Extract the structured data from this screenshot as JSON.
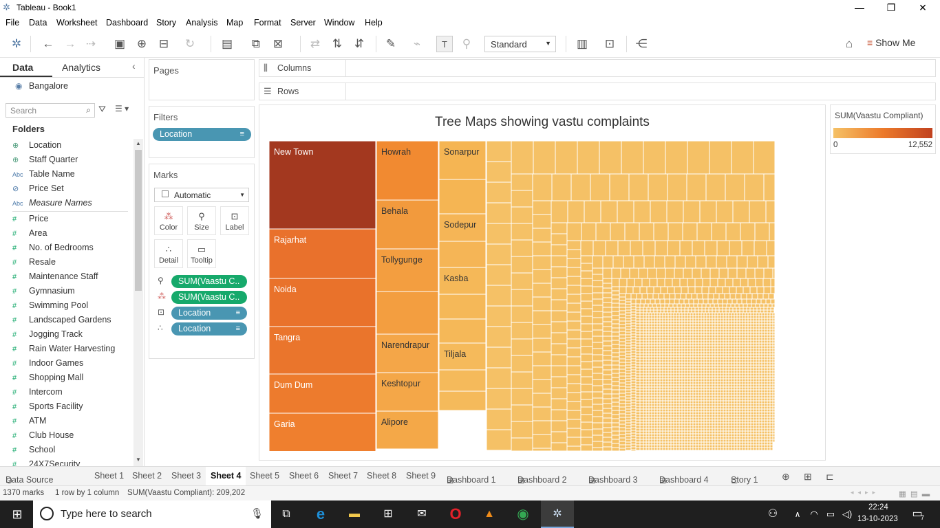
{
  "window": {
    "title": "Tableau - Book1"
  },
  "menu": [
    "File",
    "Data",
    "Worksheet",
    "Dashboard",
    "Story",
    "Analysis",
    "Map",
    "Format",
    "Server",
    "Window",
    "Help"
  ],
  "toolbar": {
    "fit_mode": "Standard",
    "show_me": "Show Me"
  },
  "datapane": {
    "tab_data": "Data",
    "tab_analytics": "Analytics",
    "datasource": "Bangalore",
    "search_placeholder": "Search",
    "folders_label": "Folders",
    "dimensions": [
      {
        "icon": "globe",
        "label": "Location"
      },
      {
        "icon": "globe",
        "label": "Staff Quarter"
      },
      {
        "icon": "abc",
        "label": "Table Name"
      },
      {
        "icon": "set",
        "label": "Price Set"
      },
      {
        "icon": "abc",
        "label": "Measure Names"
      }
    ],
    "measures": [
      "Price",
      "Area",
      "No. of Bedrooms",
      "Resale",
      "Maintenance Staff",
      "Gymnasium",
      "Swimming Pool",
      "Landscaped Gardens",
      "Jogging Track",
      "Rain Water Harvesting",
      "Indoor Games",
      "Shopping Mall",
      "Intercom",
      "Sports Facility",
      "ATM",
      "Club House",
      "School",
      "24X7Security"
    ]
  },
  "shelves": {
    "pages": "Pages",
    "filters": "Filters",
    "marks": "Marks",
    "columns": "Columns",
    "rows": "Rows",
    "filter_pill": "Location",
    "mark_type": "Automatic",
    "mark_buttons": [
      "Color",
      "Size",
      "Label",
      "Detail",
      "Tooltip"
    ],
    "mark_pills": [
      {
        "kind": "size",
        "label": "SUM(Vaastu C..",
        "color": "green"
      },
      {
        "kind": "color",
        "label": "SUM(Vaastu C..",
        "color": "green"
      },
      {
        "kind": "label",
        "label": "Location",
        "color": "blue"
      },
      {
        "kind": "detail",
        "label": "Location",
        "color": "blue"
      }
    ]
  },
  "legend": {
    "title": "SUM(Vaastu Compliant)",
    "min": "0",
    "max": "12,552",
    "colors": [
      "#f5c166",
      "#c1421f"
    ]
  },
  "chart_data": {
    "type": "treemap",
    "title": "Tree Maps showing vastu complaints",
    "measure": "SUM(Vaastu Compliant)",
    "labeled_tiles": [
      {
        "label": "New Town",
        "color": "#a3381f"
      },
      {
        "label": "Rajarhat",
        "color": "#e9712c"
      },
      {
        "label": "Noida",
        "color": "#e9722b"
      },
      {
        "label": "Tangra",
        "color": "#ea752c"
      },
      {
        "label": "Dum Dum",
        "color": "#ed7b2d"
      },
      {
        "label": "Garia",
        "color": "#ef7f2e"
      },
      {
        "label": "Howrah",
        "color": "#f18a31"
      },
      {
        "label": "Behala",
        "color": "#f29a3d"
      },
      {
        "label": "Tollygunge",
        "color": "#f39e40"
      },
      {
        "label": "",
        "color": "#f39e40"
      },
      {
        "label": "Narendrapur",
        "color": "#f4a648"
      },
      {
        "label": "Keshtopur",
        "color": "#f4a748"
      },
      {
        "label": "Alipore",
        "color": "#f4a848"
      },
      {
        "label": "Sonarpur",
        "color": "#f5b553"
      },
      {
        "label": "",
        "color": "#f5b553"
      },
      {
        "label": "Sodepur",
        "color": "#f5b556"
      },
      {
        "label": "",
        "color": "#f5b556"
      },
      {
        "label": "Kasba",
        "color": "#f5b858"
      },
      {
        "label": "",
        "color": "#f5b858"
      },
      {
        "label": "",
        "color": "#f5b858"
      },
      {
        "label": "Tiljala",
        "color": "#f5ba5b"
      },
      {
        "label": "",
        "color": "#f5ba5b"
      },
      {
        "label": "",
        "color": "#f5ba5b"
      }
    ],
    "small_tile_color": "#f5c166"
  },
  "sheets": [
    "Data Source",
    "Sheet 1",
    "Sheet 2",
    "Sheet 3",
    "Sheet 4",
    "Sheet 5",
    "Sheet 6",
    "Sheet 7",
    "Sheet 8",
    "Sheet 9",
    "Dashboard 1",
    "Dashboard 2",
    "Dashboard 3",
    "Dashboard 4",
    "Story 1"
  ],
  "active_sheet": "Sheet 4",
  "status": {
    "marks": "1370 marks",
    "dims": "1 row by 1 column",
    "sum": "SUM(Vaastu Compliant): 209,202"
  },
  "taskbar": {
    "search_placeholder": "Type here to search",
    "time": "22:24",
    "date": "13-10-2023",
    "notifications": "7"
  }
}
